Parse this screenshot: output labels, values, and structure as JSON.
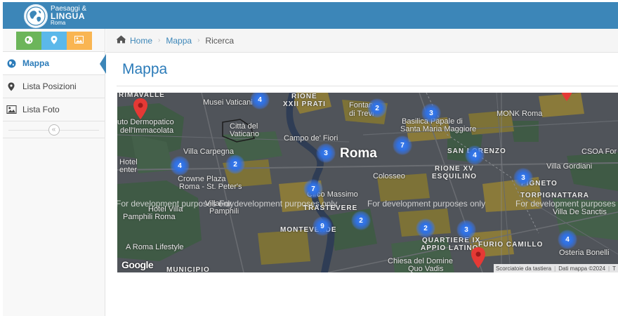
{
  "header": {
    "logo_line1": "Paesaggi &",
    "logo_line2": "LINGUA",
    "logo_line3": "Roma",
    "bg_color": "#3c86b8"
  },
  "shortcuts": [
    {
      "icon": "globe-icon",
      "color": "#6cb55a"
    },
    {
      "icon": "map-marker-icon",
      "color": "#5bb8ea"
    },
    {
      "icon": "picture-icon",
      "color": "#f9b552"
    }
  ],
  "sidebar": {
    "items": [
      {
        "label": "Mappa",
        "icon": "globe-icon",
        "active": true
      },
      {
        "label": "Lista Posizioni",
        "icon": "map-marker-icon",
        "active": false
      },
      {
        "label": "Lista Foto",
        "icon": "picture-icon",
        "active": false
      }
    ],
    "collapse_symbol": "«"
  },
  "breadcrumb": {
    "home": "Home",
    "mappa": "Mappa",
    "current": "Ricerca",
    "separator": "›"
  },
  "page": {
    "title": "Mappa"
  },
  "map": {
    "places": {
      "musei_vaticani": "Musei Vaticani",
      "rione_xxii": "RIONE",
      "rione_xxii_b": "XXII PRATI",
      "fontana": "Fontana",
      "di_trevi": "di Trevi",
      "basilica": "Basilica Papale di",
      "santa_maria": "Santa Maria Maggiore",
      "monk": "MONK Roma",
      "citta_vaticano": "Città del",
      "citta_vaticano_b": "Vaticano",
      "campo_fiori": "Campo de' Fiori",
      "roma": "Roma",
      "san_lorenzo": "SAN LORENZO",
      "csoa": "CSOA For",
      "istituto": "uto Dermopatico",
      "immacolata": "dell'Immacolata",
      "villa_carpegna": "Villa Carpegna",
      "hotel": "Hotel",
      "center": "enter",
      "crowne": "Crowne Plaza",
      "roma_st_peter": "Roma - St. Peter's",
      "colosseo": "Colosseo",
      "rione_xv": "RIONE XV",
      "esquilino": "ESQUILINO",
      "villa_gordiani": "Villa Gordiani",
      "pigneto": "PIGNETO",
      "torpignattara": "TORPIGNATTARA",
      "circo_massimo": "Circo Massimo",
      "hotel_villa": "Hotel Villa",
      "pamphili_roma": "Pamphili Roma",
      "villa_doria": "Villa",
      "pamphili": "Pamphili",
      "trastevere": "TRASTEVERE",
      "villa_sanctis": "Villa De Sanctis",
      "monteverde": "MONTEVERDE",
      "quartiere_ix": "QUARTIERE IX",
      "appio_latino": "APPIO LATINO",
      "furio_camillo": "FURIO CAMILLO",
      "a_roma_lifestyle": "A Roma Lifestyle",
      "osteria_bonelli": "Osteria Bonelli",
      "chiesa": "Chiesa del Domine",
      "quo_vadis": "Quo Vadis",
      "municipio": "MUNICIPIO",
      "rimavalle": "RIMAVALLE"
    },
    "dev_notice": "For development purposes only",
    "google": "Google",
    "attribution": {
      "shortcuts": "Scorciatoie da tastiera",
      "data": "Dati mappa ©2024",
      "terms": "T"
    },
    "clusters": [
      {
        "count": "4"
      },
      {
        "count": "2"
      },
      {
        "count": "3"
      },
      {
        "count": "3"
      },
      {
        "count": "7"
      },
      {
        "count": "4"
      },
      {
        "count": "4"
      },
      {
        "count": "2"
      },
      {
        "count": "3"
      },
      {
        "count": "7"
      },
      {
        "count": "2"
      },
      {
        "count": "9"
      },
      {
        "count": "2"
      },
      {
        "count": "3"
      },
      {
        "count": "4"
      }
    ]
  }
}
